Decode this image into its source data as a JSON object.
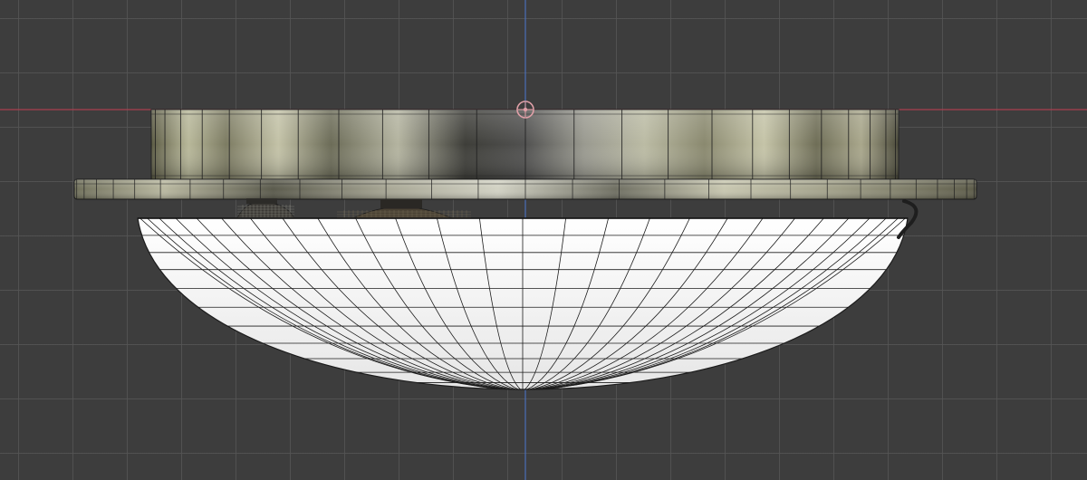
{
  "app": {
    "view": "3d-viewport",
    "projection": "orthographic-side"
  },
  "colors": {
    "background": "#3d3d3d",
    "grid_line": "#555555",
    "x_axis": "#a8404f",
    "z_axis": "#4a6fb8",
    "object_origin": "#e0a0a8",
    "diffuser": "#f2f2f2",
    "wire": "#1c1c1c",
    "metal_light": "#c8c8b0",
    "metal_dark": "#3c3c36"
  },
  "viewport": {
    "grid_visible": true,
    "axes_visible": [
      "x",
      "z"
    ],
    "origin_icon": "object-origin-icon"
  },
  "object": {
    "parts": [
      "upper-housing",
      "mounting-flange",
      "led-emitters",
      "diffuser-dome",
      "power-cable"
    ]
  }
}
